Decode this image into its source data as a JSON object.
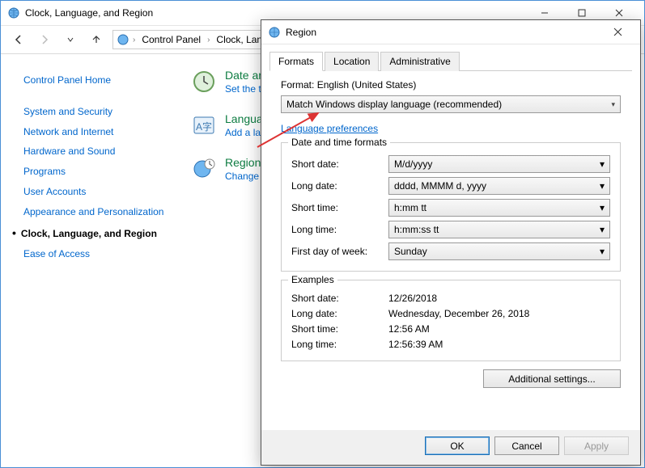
{
  "cp": {
    "title": "Clock, Language, and Region",
    "breadcrumb": {
      "root": "Control Panel",
      "current": "Clock, Language, and Region"
    },
    "sidebar": {
      "home": "Control Panel Home",
      "items": [
        "System and Security",
        "Network and Internet",
        "Hardware and Sound",
        "Programs",
        "User Accounts",
        "Appearance and Personalization",
        "Clock, Language, and Region",
        "Ease of Access"
      ],
      "activeIndex": 6
    },
    "main": {
      "groups": [
        {
          "title": "Date and Time",
          "sub": "Set the time and date"
        },
        {
          "title": "Language",
          "sub": "Add a language"
        },
        {
          "title": "Region",
          "sub": "Change location"
        }
      ]
    }
  },
  "region": {
    "title": "Region",
    "tabs": [
      "Formats",
      "Location",
      "Administrative"
    ],
    "activeTab": 0,
    "format_label": "Format:",
    "format_value": "English (United States)",
    "format_dropdown": "Match Windows display language (recommended)",
    "lang_pref": "Language preferences",
    "dtf": {
      "legend": "Date and time formats",
      "rows": [
        {
          "label": "Short date:",
          "value": "M/d/yyyy"
        },
        {
          "label": "Long date:",
          "value": "dddd, MMMM d, yyyy"
        },
        {
          "label": "Short time:",
          "value": "h:mm tt"
        },
        {
          "label": "Long time:",
          "value": "h:mm:ss tt"
        },
        {
          "label": "First day of week:",
          "value": "Sunday"
        }
      ]
    },
    "examples": {
      "legend": "Examples",
      "rows": [
        {
          "label": "Short date:",
          "value": "12/26/2018"
        },
        {
          "label": "Long date:",
          "value": "Wednesday, December 26, 2018"
        },
        {
          "label": "Short time:",
          "value": "12:56 AM"
        },
        {
          "label": "Long time:",
          "value": "12:56:39 AM"
        }
      ]
    },
    "additional": "Additional settings...",
    "buttons": {
      "ok": "OK",
      "cancel": "Cancel",
      "apply": "Apply"
    }
  }
}
